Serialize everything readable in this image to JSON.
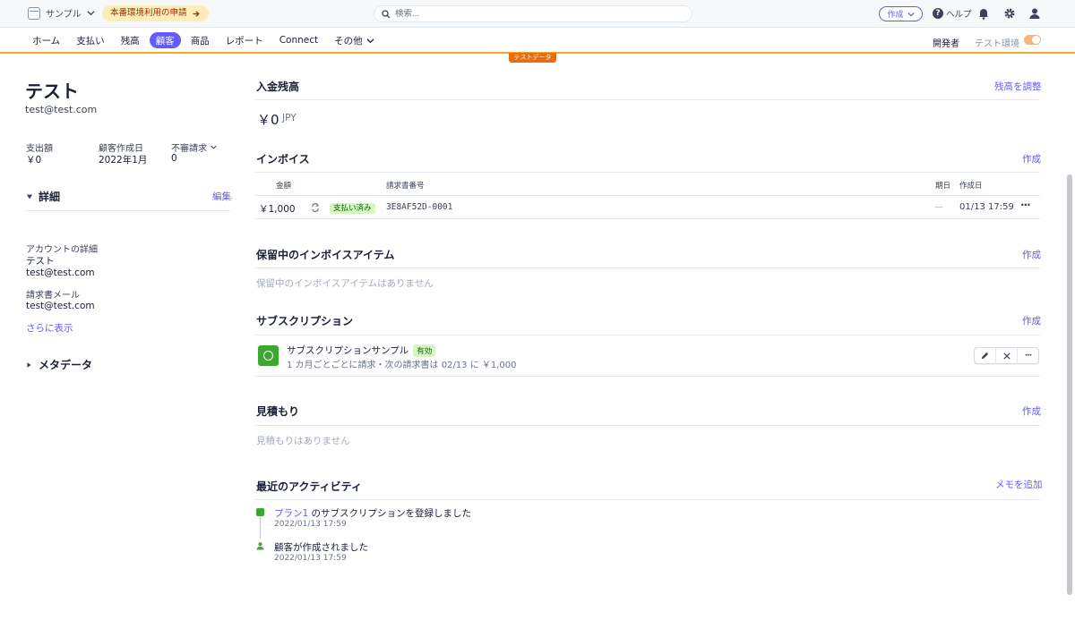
{
  "topbar": {
    "account_name": "サンプル",
    "promo_text": "本番環境利用の申請",
    "search_placeholder": "検索...",
    "create_label": "作成",
    "help_label": "ヘルプ"
  },
  "nav": {
    "items": [
      "ホーム",
      "支払い",
      "残高",
      "顧客",
      "商品",
      "レポート",
      "Connect",
      "その他"
    ],
    "active": "顧客",
    "developer_label": "開発者",
    "test_env_label": "テスト環境",
    "test_data_tag": "テストデータ"
  },
  "customer": {
    "name": "テスト",
    "email": "test@test.com",
    "stats": [
      {
        "label": "支出額",
        "value": "￥0"
      },
      {
        "label": "顧客作成日",
        "value": "2022年1月"
      },
      {
        "label": "不審請求",
        "value": "0"
      }
    ],
    "details_title": "詳細",
    "edit_label": "編集",
    "account_details_label": "アカウントの詳細",
    "account_name": "テスト",
    "account_email": "test@test.com",
    "billing_email_label": "請求書メール",
    "billing_email": "test@test.com",
    "show_more": "さらに表示",
    "metadata_title": "メタデータ"
  },
  "balance": {
    "title": "入金残高",
    "adjust_link": "残高を調整",
    "amount": "￥0",
    "currency": "JPY"
  },
  "invoices": {
    "title": "インボイス",
    "create_link": "作成",
    "headers": [
      "金額",
      "請求書番号",
      "期日",
      "作成日"
    ],
    "rows": [
      {
        "amount": "￥1,000",
        "status": "支払い済み",
        "number": "3E8AF52D-0001",
        "due": "—",
        "created": "01/13 17:59"
      }
    ]
  },
  "pending_items": {
    "title": "保留中のインボイスアイテム",
    "create_link": "作成",
    "empty": "保留中のインボイスアイテムはありません"
  },
  "subscriptions": {
    "title": "サブスクリプション",
    "create_link": "作成",
    "items": [
      {
        "name": "サブスクリプションサンプル",
        "status": "有効",
        "detail": "1 カ月ごとごとに請求・次の請求書は 02/13 に ￥1,000"
      }
    ]
  },
  "quotes": {
    "title": "見積もり",
    "create_link": "作成",
    "empty": "見積もりはありません"
  },
  "activity": {
    "title": "最近のアクティビティ",
    "add_memo": "メモを追加",
    "items": [
      {
        "link": "プラン1",
        "text": " のサブスクリプションを登録しました",
        "time": "2022/01/13 17:59"
      },
      {
        "link": "",
        "text": "顧客が作成されました",
        "time": "2022/01/13 17:59"
      }
    ]
  },
  "colors": {
    "accent": "#635bff",
    "test_orange": "#e56f19",
    "success_green": "#3ca82f",
    "promo_bg": "#fcedb9"
  }
}
